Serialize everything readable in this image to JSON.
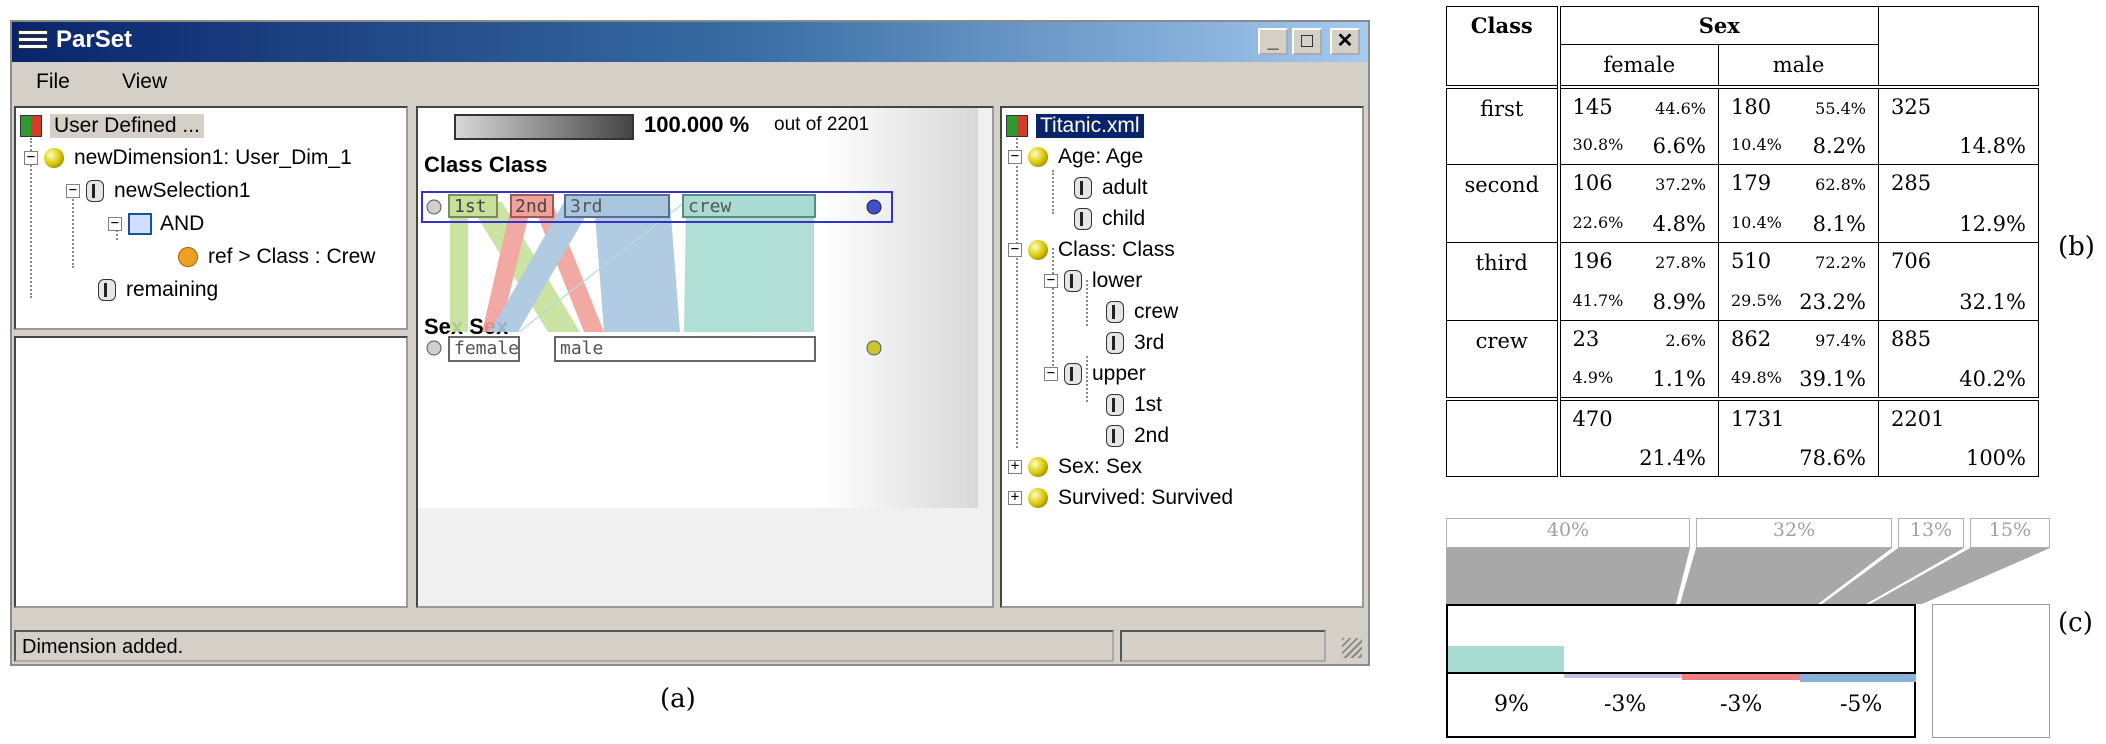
{
  "window": {
    "title": "ParSet",
    "menu": [
      "File",
      "View"
    ],
    "status": "Dimension added.",
    "caption": "(a)"
  },
  "left_tree": {
    "root": "User Defined ...",
    "items": [
      {
        "label": "newDimension1: User_Dim_1"
      },
      {
        "label": "newSelection1"
      },
      {
        "label": "AND"
      },
      {
        "label": "ref > Class : Crew"
      },
      {
        "label": "remaining"
      }
    ]
  },
  "center": {
    "percent": "100.000 %",
    "out_of": "out of 2201",
    "axis1_label": "Class Class",
    "axis1_cats": [
      "1st",
      "2nd",
      "3rd",
      "crew"
    ],
    "axis2_label": "Sex Sex",
    "axis2_cats": [
      "female",
      "male"
    ],
    "colors": {
      "first": "#c6e09a",
      "second": "#f2a09a",
      "third": "#a9c6e0",
      "crew": "#a8dcd2"
    }
  },
  "right_tree": {
    "root": "Titanic.xml",
    "items": [
      {
        "label": "Age: Age"
      },
      {
        "label": "adult"
      },
      {
        "label": "child"
      },
      {
        "label": "Class: Class"
      },
      {
        "label": "lower"
      },
      {
        "label": "crew"
      },
      {
        "label": "3rd"
      },
      {
        "label": "upper"
      },
      {
        "label": "1st"
      },
      {
        "label": "2nd"
      },
      {
        "label": "Sex: Sex"
      },
      {
        "label": "Survived: Survived"
      }
    ]
  },
  "table": {
    "caption": "(b)",
    "h_class": "Class",
    "h_sex": "Sex",
    "h_female": "female",
    "h_male": "male",
    "rows": [
      {
        "label": "first",
        "f": [
          "145",
          "44.6%",
          "30.8%",
          "6.6%"
        ],
        "m": [
          "180",
          "55.4%",
          "10.4%",
          "8.2%"
        ],
        "t": [
          "325",
          "14.8%"
        ]
      },
      {
        "label": "second",
        "f": [
          "106",
          "37.2%",
          "22.6%",
          "4.8%"
        ],
        "m": [
          "179",
          "62.8%",
          "10.4%",
          "8.1%"
        ],
        "t": [
          "285",
          "12.9%"
        ]
      },
      {
        "label": "third",
        "f": [
          "196",
          "27.8%",
          "41.7%",
          "8.9%"
        ],
        "m": [
          "510",
          "72.2%",
          "29.5%",
          "23.2%"
        ],
        "t": [
          "706",
          "32.1%"
        ]
      },
      {
        "label": "crew",
        "f": [
          "23",
          "2.6%",
          "4.9%",
          "1.1%"
        ],
        "m": [
          "862",
          "97.4%",
          "49.8%",
          "39.1%"
        ],
        "t": [
          "885",
          "40.2%"
        ]
      }
    ],
    "totals": {
      "f": [
        "470",
        "21.4%"
      ],
      "m": [
        "1731",
        "78.6%"
      ],
      "t": [
        "2201",
        "100%"
      ]
    }
  },
  "panel_c": {
    "caption": "(c)",
    "tops": [
      "40%",
      "32%",
      "13%",
      "15%"
    ],
    "diffs": [
      "9%",
      "-3%",
      "-3%",
      "-5%"
    ]
  }
}
